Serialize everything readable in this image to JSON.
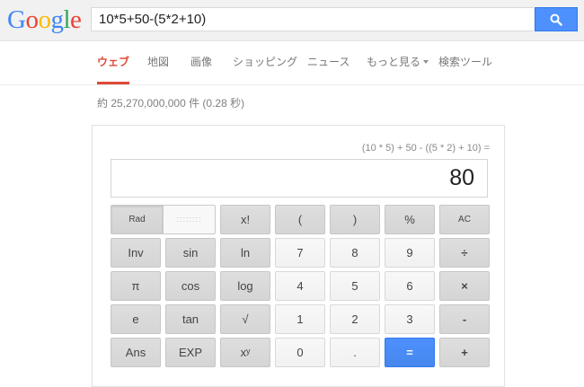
{
  "header": {
    "logo_letters": [
      {
        "ch": "G",
        "color": "#4285f4"
      },
      {
        "ch": "o",
        "color": "#ea4335"
      },
      {
        "ch": "o",
        "color": "#fbbc05"
      },
      {
        "ch": "g",
        "color": "#4285f4"
      },
      {
        "ch": "l",
        "color": "#34a853"
      },
      {
        "ch": "e",
        "color": "#ea4335"
      }
    ],
    "query": "10*5+50-(5*2+10)"
  },
  "tabs": [
    {
      "label": "ウェブ",
      "active": true
    },
    {
      "label": "地図",
      "active": false
    },
    {
      "label": "画像",
      "active": false
    },
    {
      "label": "ショッピング",
      "active": false
    },
    {
      "label": "ニュース",
      "active": false
    },
    {
      "label": "もっと見る",
      "active": false,
      "dropdown": true
    },
    {
      "label": "検索ツール",
      "active": false
    }
  ],
  "stats": "約 25,270,000,000 件 (0.28 秒)",
  "calculator": {
    "expression": "(10 * 5) + 50 - ((5 * 2) + 10) =",
    "result": "80",
    "rad_label": "Rad",
    "deg_label": "::::::::",
    "buttons": [
      {
        "label": "x!",
        "style": "dark"
      },
      {
        "label": "(",
        "style": "dark"
      },
      {
        "label": ")",
        "style": "dark"
      },
      {
        "label": "%",
        "style": "dark"
      },
      {
        "label": "AC",
        "style": "dark"
      },
      {
        "label": "Inv",
        "style": "dark"
      },
      {
        "label": "sin",
        "style": "dark"
      },
      {
        "label": "ln",
        "style": "dark"
      },
      {
        "label": "7",
        "style": "light"
      },
      {
        "label": "8",
        "style": "light"
      },
      {
        "label": "9",
        "style": "light"
      },
      {
        "label": "÷",
        "style": "dark"
      },
      {
        "label": "π",
        "style": "dark"
      },
      {
        "label": "cos",
        "style": "dark"
      },
      {
        "label": "log",
        "style": "dark"
      },
      {
        "label": "4",
        "style": "light"
      },
      {
        "label": "5",
        "style": "light"
      },
      {
        "label": "6",
        "style": "light"
      },
      {
        "label": "×",
        "style": "dark"
      },
      {
        "label": "e",
        "style": "dark"
      },
      {
        "label": "tan",
        "style": "dark"
      },
      {
        "label": "√",
        "style": "dark"
      },
      {
        "label": "1",
        "style": "light"
      },
      {
        "label": "2",
        "style": "light"
      },
      {
        "label": "3",
        "style": "light"
      },
      {
        "label": "-",
        "style": "dark"
      },
      {
        "label": "Ans",
        "style": "dark"
      },
      {
        "label": "EXP",
        "style": "dark"
      },
      {
        "label": "xʸ",
        "style": "dark"
      },
      {
        "label": "0",
        "style": "light"
      },
      {
        "label": ".",
        "style": "light"
      },
      {
        "label": "=",
        "style": "blue"
      },
      {
        "label": "+",
        "style": "dark"
      }
    ]
  }
}
